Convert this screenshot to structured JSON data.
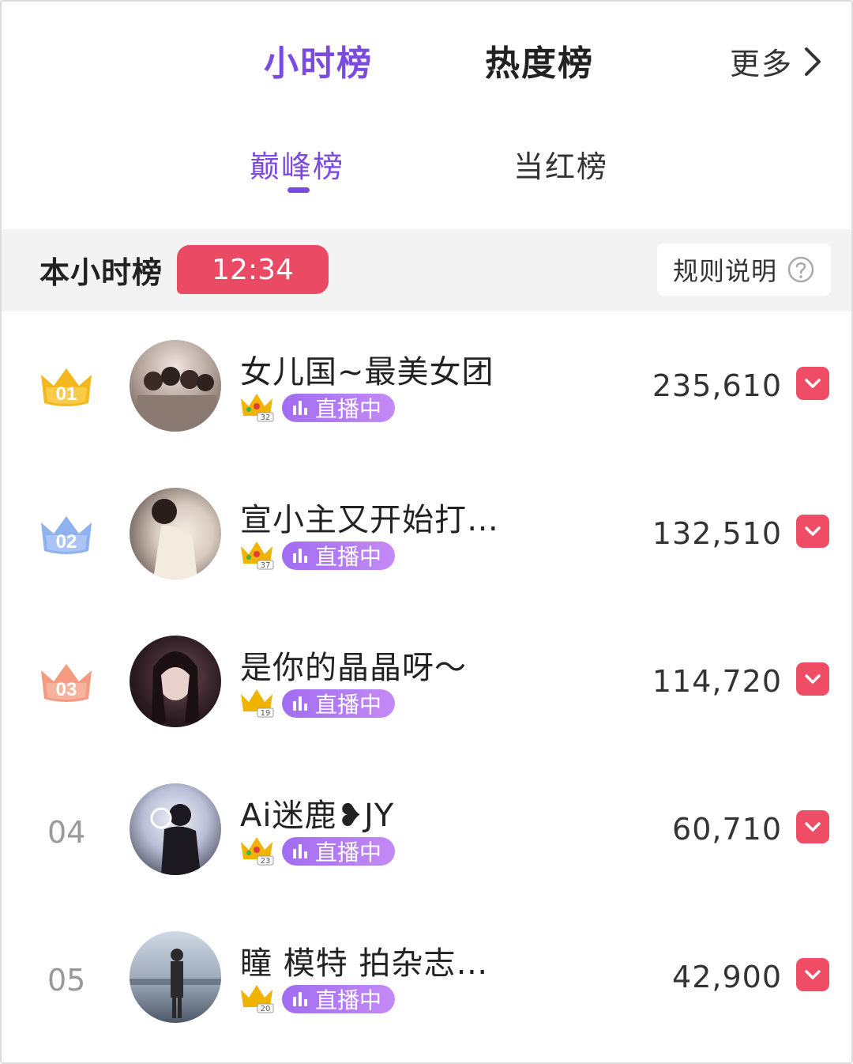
{
  "top_tabs": [
    {
      "label": "小时榜",
      "active": true
    },
    {
      "label": "热度榜",
      "active": false
    }
  ],
  "more": {
    "label": "更多",
    "icon": "chevron-right-icon"
  },
  "sub_tabs": [
    {
      "label": "巅峰榜",
      "active": true
    },
    {
      "label": "当红榜",
      "active": false
    }
  ],
  "hour_bar": {
    "title": "本小时榜",
    "timer": "12:34",
    "rules_label": "规则说明",
    "rules_icon": "question-circle-icon"
  },
  "colors": {
    "accent_purple": "#7b4be0",
    "timer_red": "#ea4a64",
    "vote_red": "#ef4d66",
    "gold": "#f4b81e",
    "silver_blue": "#8fb2ef",
    "bronze": "#f39a80"
  },
  "live_label": "直播中",
  "rows": [
    {
      "rank": "01",
      "rank_style": "gold-crown",
      "name": "女儿国~最美女团",
      "level": "32",
      "score": "235,610"
    },
    {
      "rank": "02",
      "rank_style": "silver-crown",
      "name": "宣小主又开始打…",
      "level": "37",
      "score": "132,510"
    },
    {
      "rank": "03",
      "rank_style": "bronze-crown",
      "name": "是你的晶晶呀～",
      "level": "19",
      "score": "114,720"
    },
    {
      "rank": "04",
      "rank_style": "plain",
      "name": "Ai迷鹿❥JY",
      "level": "23",
      "score": "60,710"
    },
    {
      "rank": "05",
      "rank_style": "plain",
      "name": "瞳 模特 拍杂志…",
      "level": "20",
      "score": "42,900"
    }
  ]
}
